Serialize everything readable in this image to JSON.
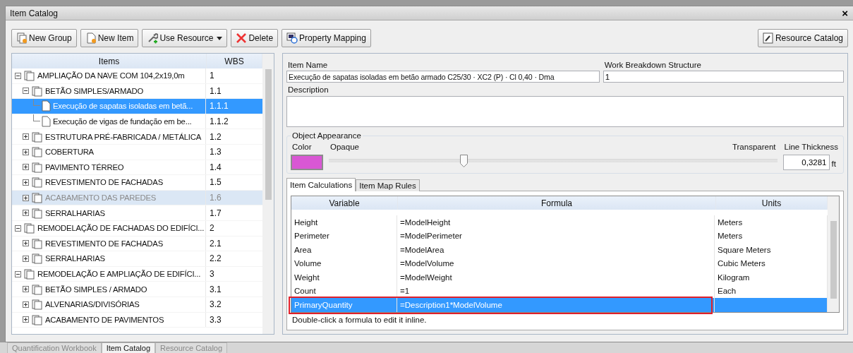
{
  "window": {
    "title": "Item Catalog",
    "close": "×"
  },
  "toolbar": [
    {
      "label": "New Group",
      "kind": "group"
    },
    {
      "label": "New Item",
      "kind": "item"
    },
    {
      "label": "Use Resource",
      "kind": "resource",
      "dropdown": true
    },
    {
      "label": "Delete",
      "kind": "delete"
    },
    {
      "label": "Property Mapping",
      "kind": "mapping"
    }
  ],
  "toolbar_right": {
    "label": "Resource Catalog"
  },
  "tree": {
    "columns": [
      "Items",
      "WBS"
    ],
    "rows": [
      {
        "label": "AMPLIAÇÃO DA NAVE COM 104,2x19,0m",
        "wbs": "1",
        "kind": "group",
        "expanded": true,
        "selected": false,
        "hovered": false,
        "children": [
          {
            "label": "BETÃO SIMPLES/ARMADO",
            "wbs": "1.1",
            "kind": "group",
            "expanded": true,
            "selected": false,
            "hovered": false,
            "children": [
              {
                "label": "Execução de sapatas isoladas em betã...",
                "wbs": "1.1.1",
                "kind": "item",
                "selected": true,
                "hovered": false
              },
              {
                "label": "Execução de vigas de fundação em be...",
                "wbs": "1.1.2",
                "kind": "item",
                "selected": false,
                "hovered": false
              }
            ]
          },
          {
            "label": "ESTRUTURA PRÉ-FABRICADA / METÁLICA",
            "wbs": "1.2",
            "kind": "group",
            "expanded": false,
            "selected": false,
            "hovered": false
          },
          {
            "label": "COBERTURA",
            "wbs": "1.3",
            "kind": "group",
            "expanded": false,
            "selected": false,
            "hovered": false
          },
          {
            "label": "PAVIMENTO TÉRREO",
            "wbs": "1.4",
            "kind": "group",
            "expanded": false,
            "selected": false,
            "hovered": false
          },
          {
            "label": "REVESTIMENTO DE FACHADAS",
            "wbs": "1.5",
            "kind": "group",
            "expanded": false,
            "selected": false,
            "hovered": false
          },
          {
            "label": "ACABAMENTO DAS PAREDES",
            "wbs": "1.6",
            "kind": "group",
            "expanded": false,
            "selected": false,
            "hovered": true
          },
          {
            "label": "SERRALHARIAS",
            "wbs": "1.7",
            "kind": "group",
            "expanded": false,
            "selected": false,
            "hovered": false
          }
        ]
      },
      {
        "label": "REMODELAÇÃO DE FACHADAS DO EDIFÍCI...",
        "wbs": "2",
        "kind": "group",
        "expanded": true,
        "selected": false,
        "hovered": false,
        "children": [
          {
            "label": "REVESTIMENTO DE FACHADAS",
            "wbs": "2.1",
            "kind": "group",
            "expanded": false,
            "selected": false,
            "hovered": false
          },
          {
            "label": "SERRALHARIAS",
            "wbs": "2.2",
            "kind": "group",
            "expanded": false,
            "selected": false,
            "hovered": false
          }
        ]
      },
      {
        "label": "REMODELAÇÃO E AMPLIAÇÃO DE EDIFÍCI...",
        "wbs": "3",
        "kind": "group",
        "expanded": true,
        "selected": false,
        "hovered": false,
        "children": [
          {
            "label": "BETÃO SIMPLES / ARMADO",
            "wbs": "3.1",
            "kind": "group",
            "expanded": false,
            "selected": false,
            "hovered": false
          },
          {
            "label": "ALVENARIAS/DIVISÓRIAS",
            "wbs": "3.2",
            "kind": "group",
            "expanded": false,
            "selected": false,
            "hovered": false
          },
          {
            "label": "ACABAMENTO DE PAVIMENTOS",
            "wbs": "3.3",
            "kind": "group",
            "expanded": false,
            "selected": false,
            "hovered": false
          }
        ]
      }
    ]
  },
  "details": {
    "item_name_label": "Item Name",
    "item_name": "Execução de sapatas isoladas em betão armado C25/30 · XC2 (P) · Cl 0,40 · Dma",
    "wbs_label": "Work Breakdown Structure",
    "wbs": "1",
    "description_label": "Description"
  },
  "appearance": {
    "title": "Object Appearance",
    "color_label": "Color",
    "color": "#d957d4",
    "opaque_label": "Opaque",
    "transparent_label": "Transparent",
    "level": 0.3,
    "thickness_label": "Line Thickness",
    "thickness": "0,3281",
    "unit": "ft"
  },
  "tabs": [
    {
      "label": "Item Calculations",
      "selected": true
    },
    {
      "label": "Item Map Rules",
      "selected": false
    }
  ],
  "calculations": {
    "columns": [
      "Variable",
      "Formula",
      "Units"
    ],
    "rows": [
      {
        "variable": "Height",
        "formula": "=ModelHeight",
        "units": "Meters",
        "selected": false
      },
      {
        "variable": "Perimeter",
        "formula": "=ModelPerimeter",
        "units": "Meters",
        "selected": false
      },
      {
        "variable": "Area",
        "formula": "=ModelArea",
        "units": "Square Meters",
        "selected": false
      },
      {
        "variable": "Volume",
        "formula": "=ModelVolume",
        "units": "Cubic Meters",
        "selected": false
      },
      {
        "variable": "Weight",
        "formula": "=ModelWeight",
        "units": "Kilogram",
        "selected": false
      },
      {
        "variable": "Count",
        "formula": "=1",
        "units": "Each",
        "selected": false
      },
      {
        "variable": "PrimaryQuantity",
        "formula": "=Description1*ModelVolume",
        "units": "",
        "selected": true,
        "highlighted": true
      }
    ],
    "hint": "Double-click a formula to edit it inline."
  },
  "bottom_tabs": [
    {
      "label": "Quantification Workbook",
      "selected": false
    },
    {
      "label": "Item Catalog",
      "selected": true
    },
    {
      "label": "Resource Catalog",
      "selected": false
    }
  ]
}
